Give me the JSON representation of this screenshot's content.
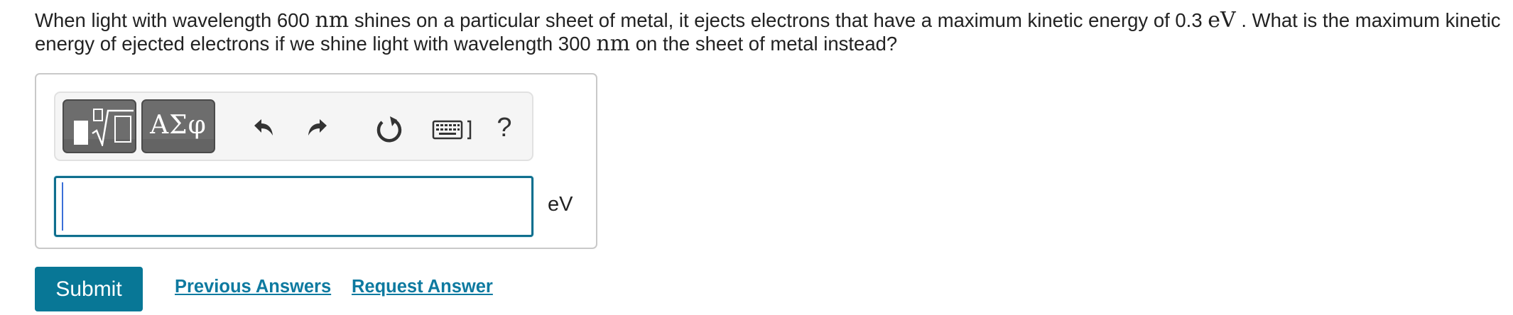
{
  "question": {
    "part1": "When light with wavelength 600 ",
    "unit1": "nm",
    "part2": "  shines on a particular sheet of metal, it ejects electrons that have a maximum kinetic energy of 0.3 ",
    "unit2": "eV",
    "part3": " .  What is the maximum kinetic energy of ejected electrons if we shine light with wavelength 300 ",
    "unit3": "nm",
    "part4": "  on the sheet of metal instead?"
  },
  "toolbar": {
    "templates_icon": "templates-radical-icon",
    "symbols_label": "ΑΣφ",
    "undo_icon": "undo-icon",
    "redo_icon": "redo-icon",
    "reset_icon": "reset-icon",
    "keyboard_icon": "keyboard-icon",
    "help_label": "?"
  },
  "answer": {
    "value": "",
    "unit": "eV"
  },
  "actions": {
    "submit_label": "Submit",
    "previous_answers_label": "Previous Answers",
    "request_answer_label": "Request Answer"
  },
  "colors": {
    "accent": "#087796",
    "link": "#0e7aa0",
    "toolbar_button": "#6d6d6d",
    "input_border": "#0f6f8e"
  }
}
